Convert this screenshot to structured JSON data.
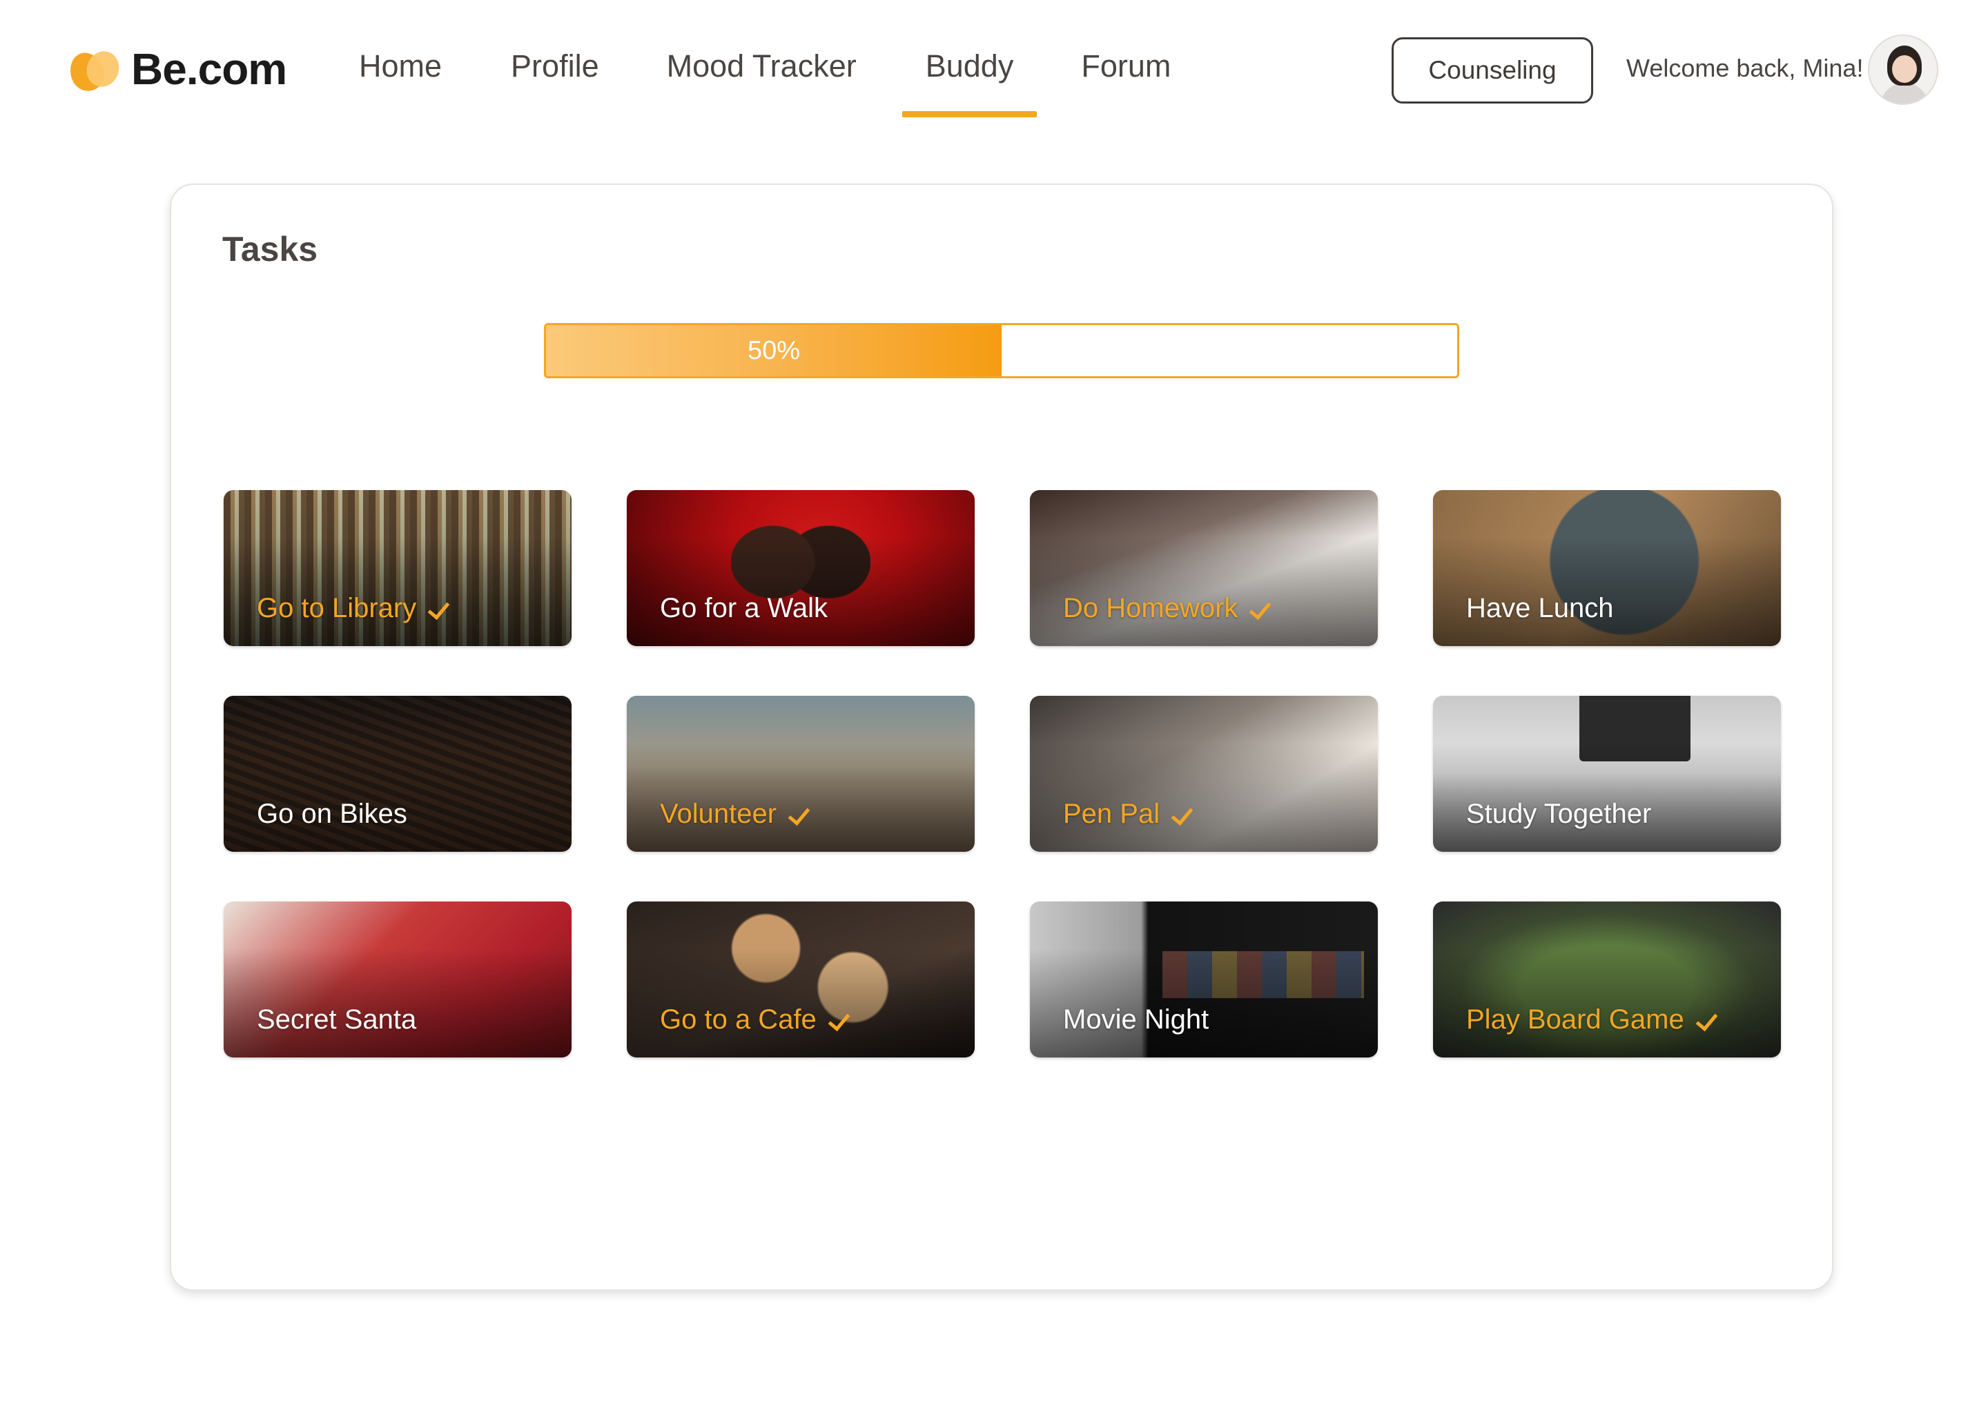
{
  "header": {
    "logo_text": "Be.com",
    "nav": [
      {
        "label": "Home",
        "active": false
      },
      {
        "label": "Profile",
        "active": false
      },
      {
        "label": "Mood Tracker",
        "active": false
      },
      {
        "label": "Buddy",
        "active": true
      },
      {
        "label": "Forum",
        "active": false
      }
    ],
    "counseling_label": "Counseling",
    "welcome_text": "Welcome back, Mina!"
  },
  "panel": {
    "title": "Tasks"
  },
  "progress": {
    "percent": 50,
    "label": "50%"
  },
  "tasks": [
    {
      "label": "Go to Library",
      "done": true,
      "image": "library-photo"
    },
    {
      "label": "Go for a Walk",
      "done": false,
      "image": "walk-photo"
    },
    {
      "label": "Do Homework",
      "done": true,
      "image": "homework-photo"
    },
    {
      "label": "Have Lunch",
      "done": false,
      "image": "lunch-photo"
    },
    {
      "label": "Go on Bikes",
      "done": false,
      "image": "bikes-photo"
    },
    {
      "label": "Volunteer",
      "done": true,
      "image": "volunteer-photo"
    },
    {
      "label": "Pen Pal",
      "done": true,
      "image": "penpal-photo"
    },
    {
      "label": "Study Together",
      "done": false,
      "image": "study-photo"
    },
    {
      "label": "Secret Santa",
      "done": false,
      "image": "santa-photo"
    },
    {
      "label": "Go to a Cafe",
      "done": true,
      "image": "cafe-photo"
    },
    {
      "label": "Movie Night",
      "done": false,
      "image": "movie-photo"
    },
    {
      "label": "Play Board Game",
      "done": true,
      "image": "boardgame-photo"
    }
  ],
  "colors": {
    "accent": "#f5a623",
    "text": "#3f3a36"
  }
}
